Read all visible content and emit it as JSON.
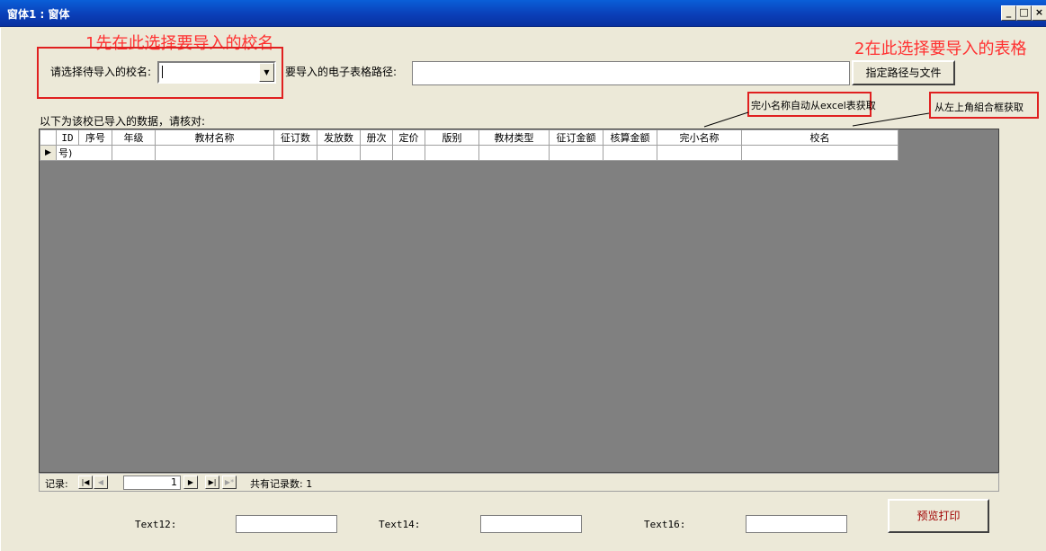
{
  "window": {
    "title": "窗体1 : 窗体",
    "min": "_",
    "max": "□",
    "close": "×"
  },
  "annotations": {
    "step1": "1先在此选择要导入的校名",
    "step2": "2在此选择要导入的表格",
    "auto_name": "完小名称自动从excel表获取",
    "from_combo": "从左上角組合框获取"
  },
  "form": {
    "school_label": "请选择待导入的校名:",
    "path_label": "要导入的电子表格路径:",
    "path_value": "",
    "school_value": "",
    "specify_button": "指定路径与文件",
    "grid_caption": "以下为该校已导入的数据，请核对:",
    "preview_button": "预览打印"
  },
  "grid": {
    "columns": [
      "ID",
      "序号",
      "年级",
      "教材名称",
      "征订数",
      "发放数",
      "册次",
      "定价",
      "版别",
      "教材类型",
      "征订金额",
      "核算金额",
      "完小名称",
      "校名"
    ],
    "row_id": "号)"
  },
  "navigator": {
    "label": "记录:",
    "current": "1",
    "total_label": "共有记录数: 1"
  },
  "footer": {
    "text12": "Text12:",
    "text14": "Text14:",
    "text16": "Text16:"
  }
}
